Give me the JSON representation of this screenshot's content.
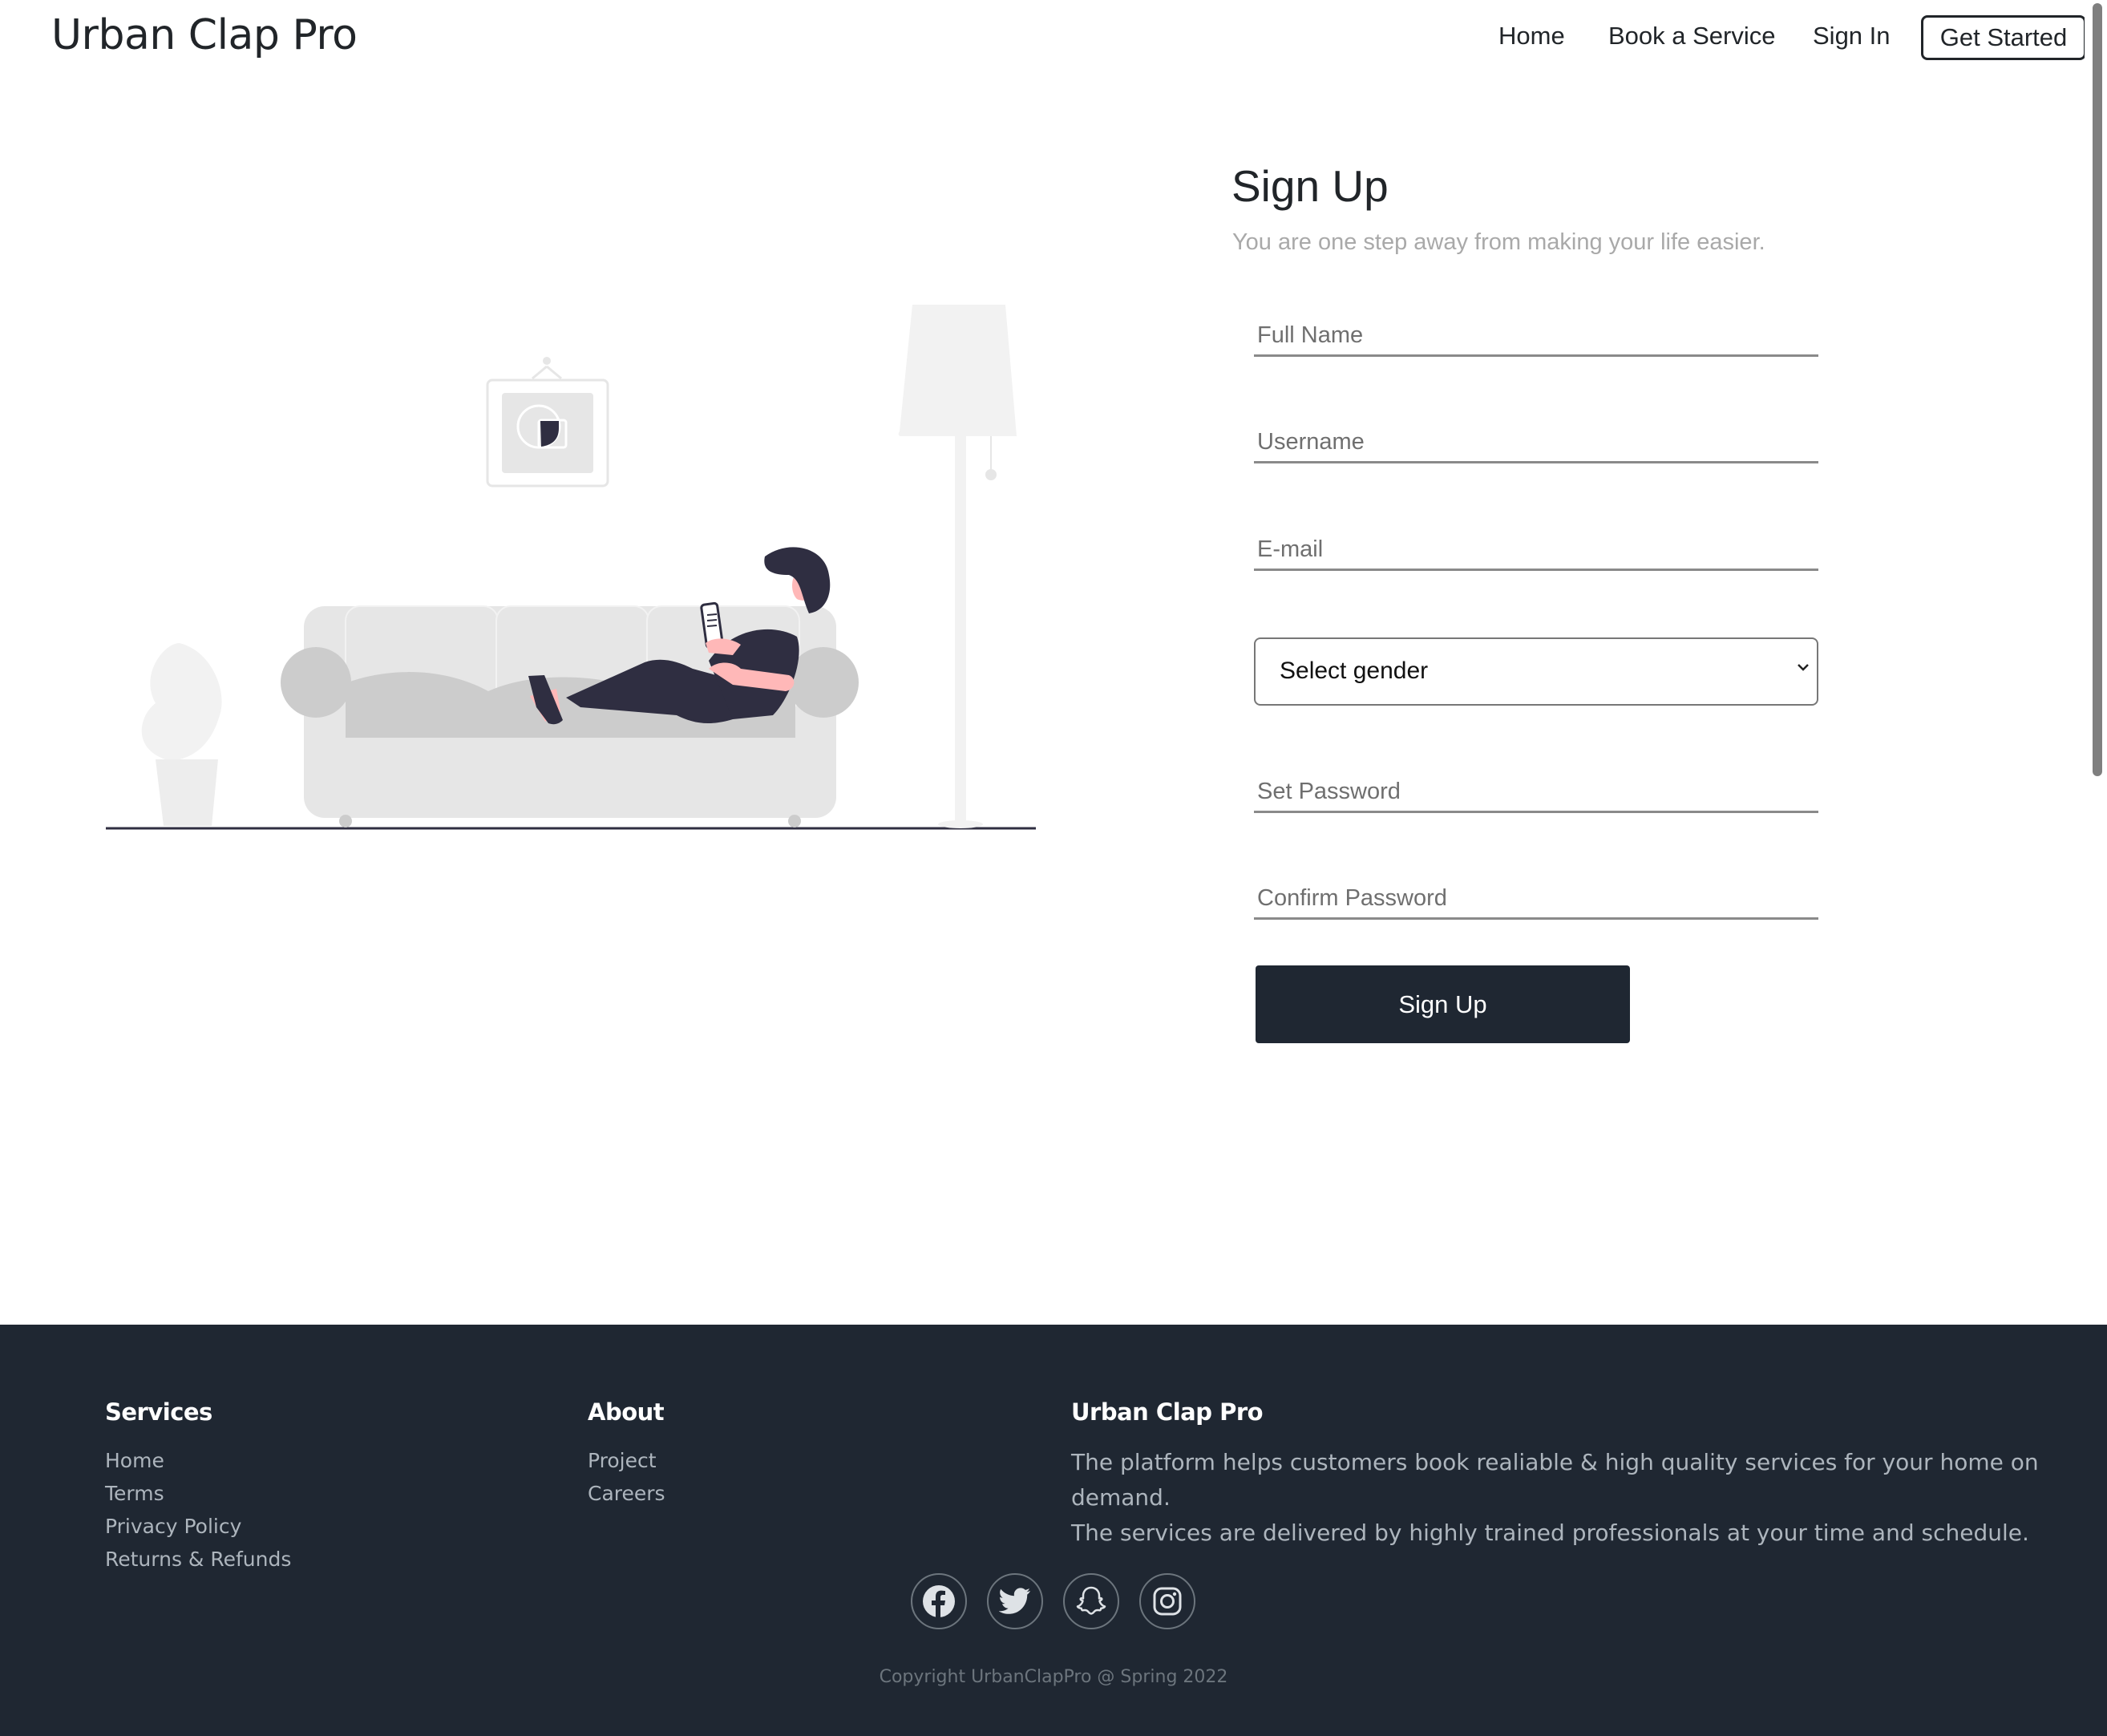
{
  "header": {
    "brand": "Urban Clap Pro",
    "nav": [
      "Home",
      "Book a Service",
      "Sign In"
    ],
    "cta": "Get Started"
  },
  "form": {
    "title": "Sign Up",
    "subtitle": "You are one step away from making your life easier.",
    "full_name_placeholder": "Full Name",
    "username_placeholder": "Username",
    "email_placeholder": "E-mail",
    "gender_selected": "Select gender",
    "password_placeholder": "Set Password",
    "confirm_password_placeholder": "Confirm Password",
    "submit_label": "Sign Up"
  },
  "footer": {
    "services_title": "Services",
    "services_links": [
      "Home",
      "Terms",
      "Privacy Policy",
      "Returns & Refunds"
    ],
    "about_title": "About",
    "about_links": [
      "Project",
      "Careers"
    ],
    "brand_title": "Urban Clap Pro",
    "description_line1": "The platform helps customers book realiable & high quality services for your home on demand.",
    "description_line2": "The services are delivered by highly trained professionals at your time and schedule.",
    "social_icons": [
      "facebook-icon",
      "twitter-icon",
      "snapchat-icon",
      "instagram-icon"
    ],
    "copyright": "Copyright UrbanClapPro @ Spring 2022"
  },
  "colors": {
    "footer_bg": "#1f2732",
    "button_bg": "#1f2732",
    "subtitle": "#a9a9a9"
  }
}
